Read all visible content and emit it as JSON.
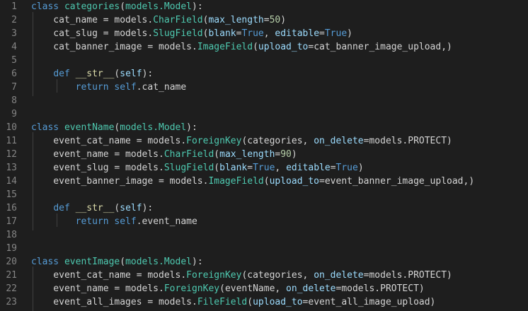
{
  "editor": {
    "language": "python",
    "theme_colors": {
      "background": "#1e1e1e",
      "line_number": "#858585",
      "text": "#d4d4d4",
      "keyword": "#569cd6",
      "class_name": "#4ec9b0",
      "function": "#dcdcaa",
      "number": "#b5cea8",
      "parameter": "#9cdcfe"
    },
    "lines": [
      {
        "number": "1",
        "tokens": [
          {
            "t": "class",
            "k": "kw"
          },
          {
            "t": " ",
            "k": "txt"
          },
          {
            "t": "categories",
            "k": "cls"
          },
          {
            "t": "(",
            "k": "txt"
          },
          {
            "t": "models.Model",
            "k": "cls"
          },
          {
            "t": "):",
            "k": "txt"
          }
        ]
      },
      {
        "number": "2",
        "tokens": [
          {
            "t": "    cat_name = models.",
            "k": "txt"
          },
          {
            "t": "CharField",
            "k": "cls"
          },
          {
            "t": "(",
            "k": "txt"
          },
          {
            "t": "max_length",
            "k": "param"
          },
          {
            "t": "=",
            "k": "txt"
          },
          {
            "t": "50",
            "k": "num"
          },
          {
            "t": ")",
            "k": "txt"
          }
        ]
      },
      {
        "number": "3",
        "tokens": [
          {
            "t": "    cat_slug = models.",
            "k": "txt"
          },
          {
            "t": "SlugField",
            "k": "cls"
          },
          {
            "t": "(",
            "k": "txt"
          },
          {
            "t": "blank",
            "k": "param"
          },
          {
            "t": "=",
            "k": "txt"
          },
          {
            "t": "True",
            "k": "kw"
          },
          {
            "t": ", ",
            "k": "txt"
          },
          {
            "t": "editable",
            "k": "param"
          },
          {
            "t": "=",
            "k": "txt"
          },
          {
            "t": "True",
            "k": "kw"
          },
          {
            "t": ")",
            "k": "txt"
          }
        ]
      },
      {
        "number": "4",
        "tokens": [
          {
            "t": "    cat_banner_image = models.",
            "k": "txt"
          },
          {
            "t": "ImageField",
            "k": "cls"
          },
          {
            "t": "(",
            "k": "txt"
          },
          {
            "t": "upload_to",
            "k": "param"
          },
          {
            "t": "=cat_banner_image_upload,)",
            "k": "txt"
          }
        ]
      },
      {
        "number": "5",
        "tokens": []
      },
      {
        "number": "6",
        "tokens": [
          {
            "t": "    ",
            "k": "txt"
          },
          {
            "t": "def",
            "k": "kw"
          },
          {
            "t": " ",
            "k": "txt"
          },
          {
            "t": "__str__",
            "k": "fn"
          },
          {
            "t": "(",
            "k": "txt"
          },
          {
            "t": "self",
            "k": "param"
          },
          {
            "t": "):",
            "k": "txt"
          }
        ]
      },
      {
        "number": "7",
        "tokens": [
          {
            "t": "        ",
            "k": "txt"
          },
          {
            "t": "return",
            "k": "kw"
          },
          {
            "t": " ",
            "k": "txt"
          },
          {
            "t": "self",
            "k": "kw"
          },
          {
            "t": ".cat_name",
            "k": "txt"
          }
        ]
      },
      {
        "number": "8",
        "tokens": []
      },
      {
        "number": "9",
        "tokens": []
      },
      {
        "number": "10",
        "tokens": [
          {
            "t": "class",
            "k": "kw"
          },
          {
            "t": " ",
            "k": "txt"
          },
          {
            "t": "eventName",
            "k": "cls"
          },
          {
            "t": "(",
            "k": "txt"
          },
          {
            "t": "models.Model",
            "k": "cls"
          },
          {
            "t": "):",
            "k": "txt"
          }
        ]
      },
      {
        "number": "11",
        "tokens": [
          {
            "t": "    event_cat_name = models.",
            "k": "txt"
          },
          {
            "t": "ForeignKey",
            "k": "cls"
          },
          {
            "t": "(categories, ",
            "k": "txt"
          },
          {
            "t": "on_delete",
            "k": "param"
          },
          {
            "t": "=models.PROTECT)",
            "k": "txt"
          }
        ]
      },
      {
        "number": "12",
        "tokens": [
          {
            "t": "    event_name = models.",
            "k": "txt"
          },
          {
            "t": "CharField",
            "k": "cls"
          },
          {
            "t": "(",
            "k": "txt"
          },
          {
            "t": "max_length",
            "k": "param"
          },
          {
            "t": "=",
            "k": "txt"
          },
          {
            "t": "90",
            "k": "num"
          },
          {
            "t": ")",
            "k": "txt"
          }
        ]
      },
      {
        "number": "13",
        "tokens": [
          {
            "t": "    event_slug = models.",
            "k": "txt"
          },
          {
            "t": "SlugField",
            "k": "cls"
          },
          {
            "t": "(",
            "k": "txt"
          },
          {
            "t": "blank",
            "k": "param"
          },
          {
            "t": "=",
            "k": "txt"
          },
          {
            "t": "True",
            "k": "kw"
          },
          {
            "t": ", ",
            "k": "txt"
          },
          {
            "t": "editable",
            "k": "param"
          },
          {
            "t": "=",
            "k": "txt"
          },
          {
            "t": "True",
            "k": "kw"
          },
          {
            "t": ")",
            "k": "txt"
          }
        ]
      },
      {
        "number": "14",
        "tokens": [
          {
            "t": "    event_banner_image = models.",
            "k": "txt"
          },
          {
            "t": "ImageField",
            "k": "cls"
          },
          {
            "t": "(",
            "k": "txt"
          },
          {
            "t": "upload_to",
            "k": "param"
          },
          {
            "t": "=event_banner_image_upload,)",
            "k": "txt"
          }
        ]
      },
      {
        "number": "15",
        "tokens": []
      },
      {
        "number": "16",
        "tokens": [
          {
            "t": "    ",
            "k": "txt"
          },
          {
            "t": "def",
            "k": "kw"
          },
          {
            "t": " ",
            "k": "txt"
          },
          {
            "t": "__str__",
            "k": "fn"
          },
          {
            "t": "(",
            "k": "txt"
          },
          {
            "t": "self",
            "k": "param"
          },
          {
            "t": "):",
            "k": "txt"
          }
        ]
      },
      {
        "number": "17",
        "tokens": [
          {
            "t": "        ",
            "k": "txt"
          },
          {
            "t": "return",
            "k": "kw"
          },
          {
            "t": " ",
            "k": "txt"
          },
          {
            "t": "self",
            "k": "kw"
          },
          {
            "t": ".event_name",
            "k": "txt"
          }
        ]
      },
      {
        "number": "18",
        "tokens": []
      },
      {
        "number": "19",
        "tokens": []
      },
      {
        "number": "20",
        "tokens": [
          {
            "t": "class",
            "k": "kw"
          },
          {
            "t": " ",
            "k": "txt"
          },
          {
            "t": "eventImage",
            "k": "cls"
          },
          {
            "t": "(",
            "k": "txt"
          },
          {
            "t": "models.Model",
            "k": "cls"
          },
          {
            "t": "):",
            "k": "txt"
          }
        ]
      },
      {
        "number": "21",
        "tokens": [
          {
            "t": "    event_cat_name = models.",
            "k": "txt"
          },
          {
            "t": "ForeignKey",
            "k": "cls"
          },
          {
            "t": "(categories, ",
            "k": "txt"
          },
          {
            "t": "on_delete",
            "k": "param"
          },
          {
            "t": "=models.PROTECT)",
            "k": "txt"
          }
        ]
      },
      {
        "number": "22",
        "tokens": [
          {
            "t": "    event_name = models.",
            "k": "txt"
          },
          {
            "t": "ForeignKey",
            "k": "cls"
          },
          {
            "t": "(eventName, ",
            "k": "txt"
          },
          {
            "t": "on_delete",
            "k": "param"
          },
          {
            "t": "=models.PROTECT)",
            "k": "txt"
          }
        ]
      },
      {
        "number": "23",
        "tokens": [
          {
            "t": "    event_all_images = models.",
            "k": "txt"
          },
          {
            "t": "FileField",
            "k": "cls"
          },
          {
            "t": "(",
            "k": "txt"
          },
          {
            "t": "upload_to",
            "k": "param"
          },
          {
            "t": "=event_all_image_upload)",
            "k": "txt"
          }
        ]
      }
    ]
  }
}
